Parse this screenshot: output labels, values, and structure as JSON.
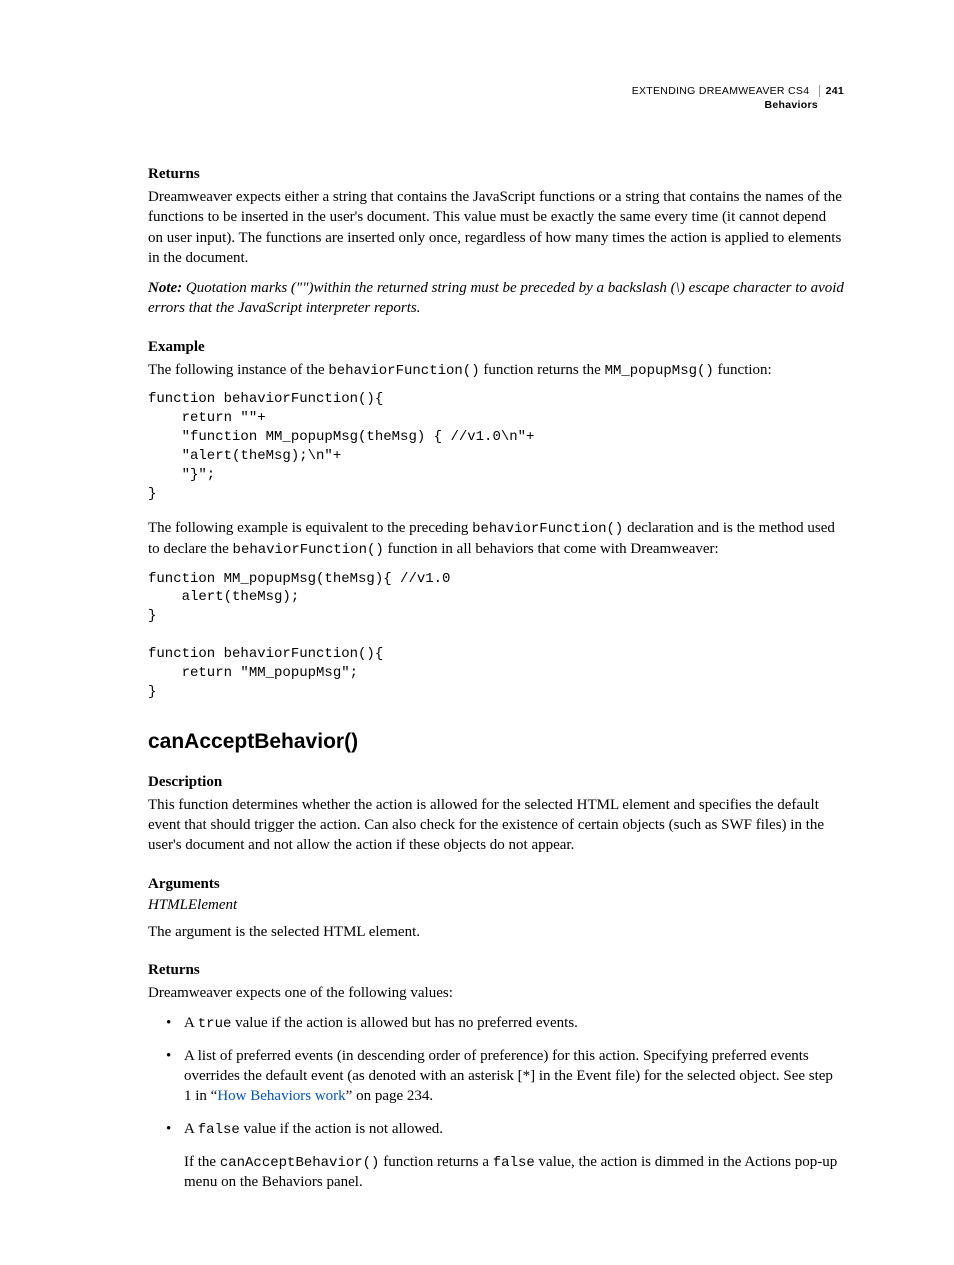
{
  "header": {
    "book_title": "EXTENDING DREAMWEAVER CS4",
    "page_number": "241",
    "chapter": "Behaviors"
  },
  "section1": {
    "returns_heading": "Returns",
    "returns_body": "Dreamweaver expects either a string that contains the JavaScript functions or a string that contains the names of the functions to be inserted in the user's document. This value must be exactly the same every time (it cannot depend on user input). The functions are inserted only once, regardless of how many times the action is applied to elements in the document.",
    "note_lead": "Note:",
    "note_body": " Quotation marks (\"\")within the returned string must be preceded by a backslash (\\) escape character to avoid errors that the JavaScript interpreter reports.",
    "example_heading": "Example",
    "example_intro_pre": "The following instance of the ",
    "example_intro_code1": "behaviorFunction()",
    "example_intro_mid": " function returns the ",
    "example_intro_code2": "MM_popupMsg()",
    "example_intro_post": " function:",
    "code1": "function behaviorFunction(){\n    return \"\"+\n    \"function MM_popupMsg(theMsg) { //v1.0\\n\"+\n    \"alert(theMsg);\\n\"+\n    \"}\";\n}",
    "para2_pre": "The following example is equivalent to the preceding ",
    "para2_code1": "behaviorFunction()",
    "para2_mid": " declaration and is the method used to declare the ",
    "para2_code2": "behaviorFunction()",
    "para2_post": " function in all behaviors that come with Dreamweaver:",
    "code2": "function MM_popupMsg(theMsg){ //v1.0\n    alert(theMsg);\n}\n\nfunction behaviorFunction(){\n    return \"MM_popupMsg\";\n}"
  },
  "section2": {
    "title": "canAcceptBehavior()",
    "description_heading": "Description",
    "description_body": "This function determines whether the action is allowed for the selected HTML element and specifies the default event that should trigger the action. Can also check for the existence of certain objects (such as SWF files) in the user's document and not allow the action if these objects do not appear.",
    "arguments_heading": "Arguments",
    "arguments_name": "HTMLElement",
    "arguments_body": "The argument is the selected HTML element.",
    "returns_heading": "Returns",
    "returns_intro": "Dreamweaver expects one of the following values:",
    "bullets": {
      "b1_pre": "A ",
      "b1_code": "true",
      "b1_post": " value if the action is allowed but has no preferred events.",
      "b2_pre": "A list of preferred events (in descending order of preference) for this action. Specifying preferred events overrides the default event (as denoted with an asterisk [*] in the Event file) for the selected object. See step 1 in “",
      "b2_link": "How Behaviors work",
      "b2_post": "” on page 234.",
      "b3_pre": "A ",
      "b3_code": "false",
      "b3_post": " value if the action is not allowed.",
      "b3_sub_pre": "If the ",
      "b3_sub_code1": "canAcceptBehavior()",
      "b3_sub_mid": " function returns a ",
      "b3_sub_code2": "false",
      "b3_sub_post": " value, the action is dimmed in the Actions pop-up menu on the Behaviors panel."
    }
  }
}
